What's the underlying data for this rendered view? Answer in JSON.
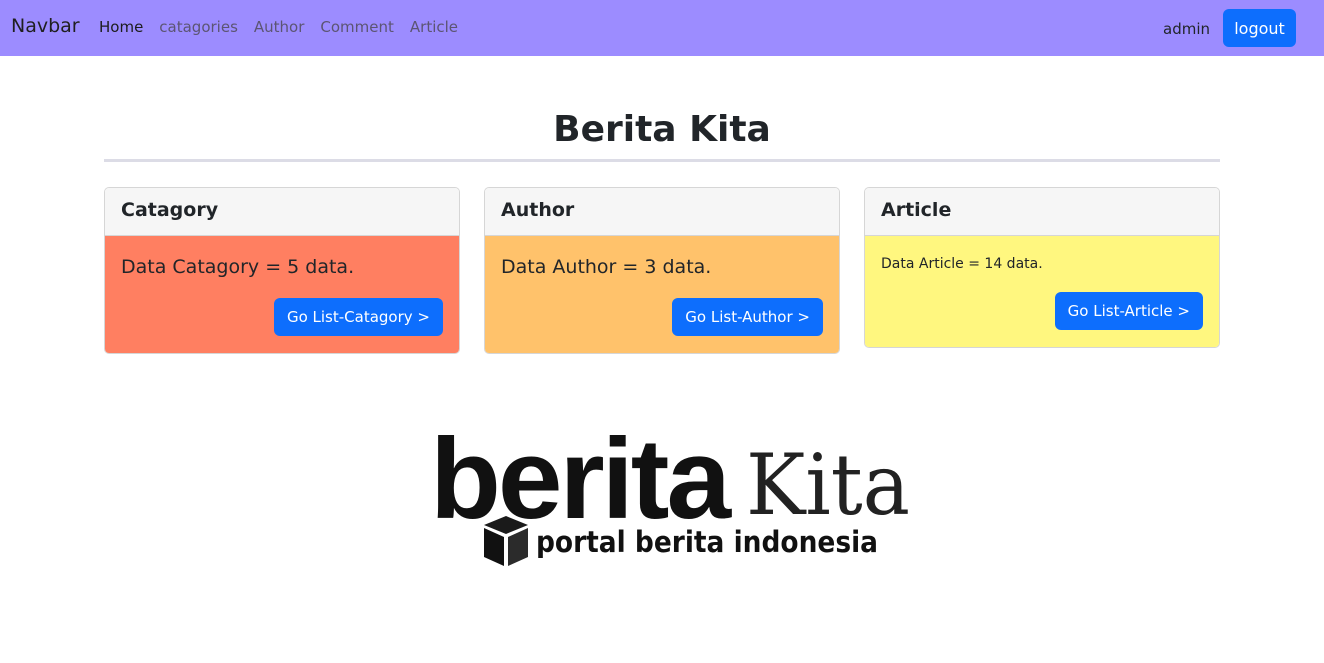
{
  "navbar": {
    "brand": "Navbar",
    "links": [
      "Home",
      "catagories",
      "Author",
      "Comment",
      "Article"
    ],
    "user": "admin",
    "logout_label": "logout",
    "background": "#9c8cff"
  },
  "main": {
    "title": "Berita Kita",
    "cards": [
      {
        "header": "Catagory",
        "text": "Data Catagory = 5 data.",
        "button": "Go List-Catagory >",
        "color": "#ff7f61"
      },
      {
        "header": "Author",
        "text": "Data Author = 3 data.",
        "button": "Go List-Author >",
        "color": "#ffc26b"
      },
      {
        "header": "Article",
        "text": "Data Article = 14 data.",
        "button": "Go List-Article >",
        "color": "#fff77f"
      }
    ]
  },
  "logo": {
    "word1": "berita",
    "word2": "Kita",
    "tagline": "portal berita indonesia",
    "icon": "cube-icon"
  },
  "colors": {
    "accent": "#0d6efd"
  }
}
